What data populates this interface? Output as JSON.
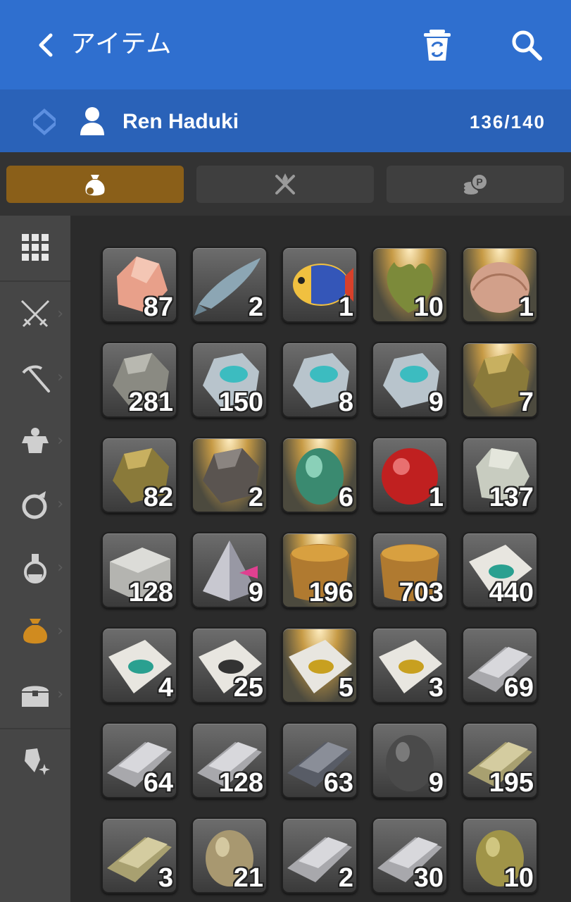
{
  "header": {
    "title": "アイテム",
    "back_icon": "chevron-left-icon",
    "trash_icon": "recycle-trash-icon",
    "search_icon": "search-icon",
    "color": "#2f6fcf"
  },
  "character": {
    "name": "Ren Haduki",
    "capacity": "136/140",
    "swap_icon": "swap-character-icon",
    "user_icon": "user-icon"
  },
  "tabs": [
    {
      "name": "bag-tab",
      "icon": "pouch-icon",
      "active": true
    },
    {
      "name": "crystal-tab",
      "icon": "crystal-tools-icon",
      "active": false
    },
    {
      "name": "currency-tab",
      "icon": "coins-icon",
      "active": false
    }
  ],
  "sidebar": {
    "items": [
      {
        "name": "all-items",
        "icon": "grid-icon"
      },
      {
        "name": "arms",
        "icon": "crossed-swords-icon"
      },
      {
        "name": "tools",
        "icon": "pickaxe-icon"
      },
      {
        "name": "armor",
        "icon": "armor-icon"
      },
      {
        "name": "food",
        "icon": "food-icon"
      },
      {
        "name": "medicine",
        "icon": "flask-icon"
      },
      {
        "name": "materials",
        "icon": "pouch-icon",
        "active": true
      },
      {
        "name": "chest",
        "icon": "chest-icon"
      },
      {
        "name": "crystals",
        "icon": "shard-icon"
      }
    ],
    "active_color": "#d08b1f"
  },
  "items": [
    {
      "kind": "rock-salt",
      "qty": "87"
    },
    {
      "kind": "fish",
      "qty": "2"
    },
    {
      "kind": "tropical-fish",
      "qty": "1"
    },
    {
      "kind": "leaf",
      "qty": "10"
    },
    {
      "kind": "shell",
      "qty": "1"
    },
    {
      "kind": "grey-ore",
      "qty": "281"
    },
    {
      "kind": "teal-ore",
      "qty": "150"
    },
    {
      "kind": "teal-ore",
      "qty": "8"
    },
    {
      "kind": "teal-ore",
      "qty": "9"
    },
    {
      "kind": "gold-ore",
      "qty": "7"
    },
    {
      "kind": "gold-ore",
      "qty": "82"
    },
    {
      "kind": "dark-ore",
      "qty": "2"
    },
    {
      "kind": "green-gem",
      "qty": "6"
    },
    {
      "kind": "red-orb",
      "qty": "1"
    },
    {
      "kind": "white-ore",
      "qty": "137"
    },
    {
      "kind": "stone-block",
      "qty": "128"
    },
    {
      "kind": "prism",
      "qty": "9"
    },
    {
      "kind": "sack",
      "qty": "196"
    },
    {
      "kind": "sack",
      "qty": "703"
    },
    {
      "kind": "paper-teal",
      "qty": "440"
    },
    {
      "kind": "paper-teal",
      "qty": "4"
    },
    {
      "kind": "paper-black",
      "qty": "25"
    },
    {
      "kind": "paper-gold",
      "qty": "5"
    },
    {
      "kind": "paper-gold",
      "qty": "3"
    },
    {
      "kind": "silver-ingot",
      "qty": "69"
    },
    {
      "kind": "silver-ingot",
      "qty": "64"
    },
    {
      "kind": "silver-ingot",
      "qty": "128"
    },
    {
      "kind": "dark-ingot",
      "qty": "63"
    },
    {
      "kind": "black-nugget",
      "qty": "9"
    },
    {
      "kind": "gold-ingot",
      "qty": "195"
    },
    {
      "kind": "gold-ingot",
      "qty": "3"
    },
    {
      "kind": "tan-nugget",
      "qty": "21"
    },
    {
      "kind": "silver-ingot",
      "qty": "2"
    },
    {
      "kind": "silver-ingot",
      "qty": "30"
    },
    {
      "kind": "olive-nugget",
      "qty": "10"
    }
  ]
}
